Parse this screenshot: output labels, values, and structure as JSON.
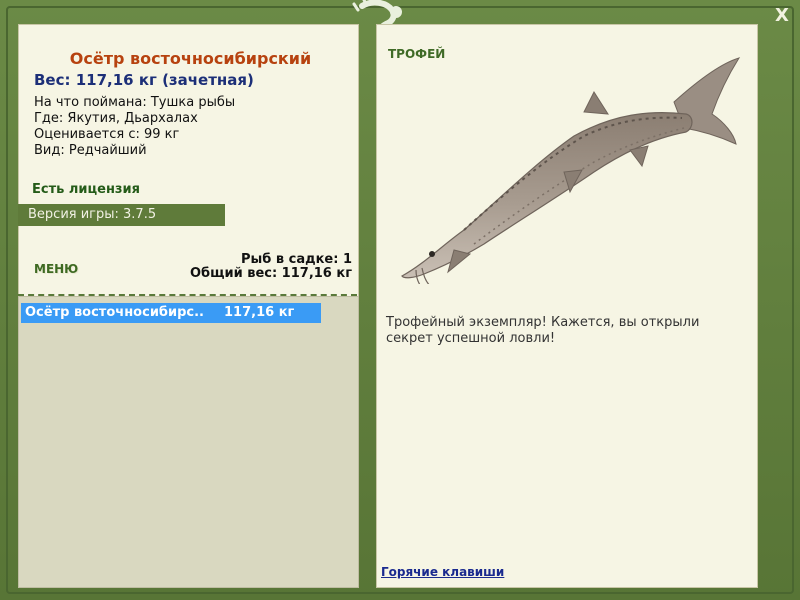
{
  "fish": {
    "title": "Осётр восточносибирский",
    "weight_line": "Вес: 117,16 кг (зачетная)",
    "bait": "На что поймана: Тушка рыбы",
    "location": "Где: Якутия, Дьархалах",
    "rated_from": "Оценивается с: 99 кг",
    "rarity": "Вид: Редчайший"
  },
  "license": "Есть лицензия",
  "version": "Версия игры: 3.7.5",
  "menu_label": "МЕНЮ",
  "keepnet": {
    "count": "Рыб в садке: 1",
    "total_weight": "Общий вес: 117,16 кг"
  },
  "catch_list": [
    {
      "name": "Осётр восточносибирс...",
      "weight": "117,16 кг"
    }
  ],
  "trophy": {
    "title": "ТРОФЕЙ",
    "message": "Трофейный экземпляр! Кажется, вы открыли секрет успешной ловли!"
  },
  "hotkeys_link": "Горячие клавиши",
  "close_label": "X",
  "colors": {
    "frame_green": "#5f7b3a",
    "panel_bg": "#f6f5e4",
    "title_orange": "#b7420f",
    "weight_blue": "#1c2f78",
    "selection_blue": "#3a9bf5"
  },
  "icons": {
    "logo": "lizard-logo-icon",
    "close": "close-icon",
    "fish": "sturgeon-image"
  }
}
